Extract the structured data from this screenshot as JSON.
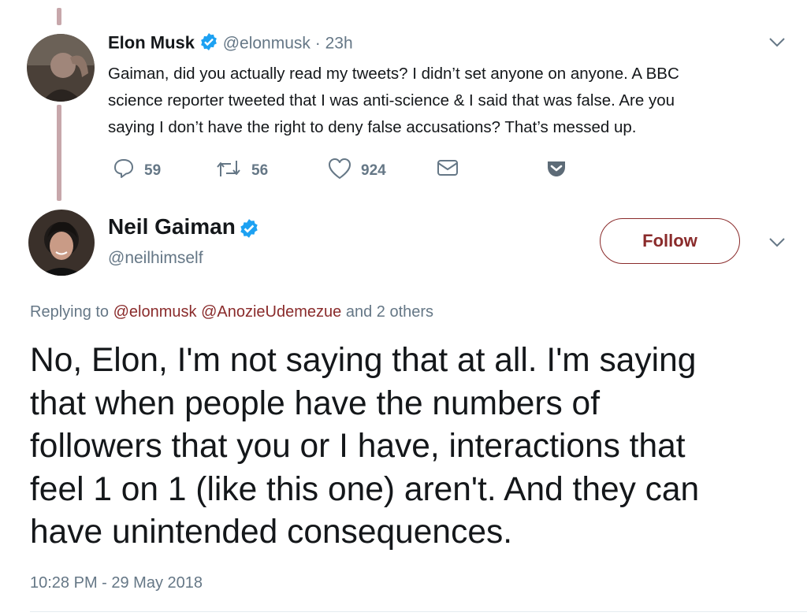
{
  "tweet1": {
    "name": "Elon Musk",
    "handle": "@elonmusk",
    "separator": "·",
    "time": "23h",
    "lines": [
      "Gaiman, did you actually read my tweets? I didn’t set anyone on anyone. A BBC",
      "science reporter tweeted that I was anti-science & I said that was false. Are you",
      "saying I don’t have the right to deny false accusations? That’s messed up."
    ],
    "replies": "59",
    "retweets": "56",
    "likes": "924"
  },
  "tweet2": {
    "name": "Neil Gaiman",
    "handle": "@neilhimself",
    "follow_label": "Follow",
    "replying_prefix": "Replying to",
    "replying_users": [
      "@elonmusk",
      "@AnozieUdemezue"
    ],
    "replying_suffix": "and 2 others",
    "lines": [
      "No, Elon, I'm not saying that at all. I'm saying",
      "that when people have the numbers of",
      "followers that you or I have, interactions that",
      "feel 1 on 1 (like this one) aren't. And they can",
      "have unintended consequences."
    ],
    "timestamp": "10:28 PM - 29 May 2018"
  },
  "colors": {
    "accent": "#8a2b2b",
    "verified": "#1da1f2",
    "muted": "#657786",
    "thread": "#c7a7ab"
  },
  "icons": [
    "verified-badge-icon",
    "chevron-down-icon",
    "reply-icon",
    "retweet-icon",
    "like-icon",
    "message-icon",
    "pocket-icon"
  ]
}
